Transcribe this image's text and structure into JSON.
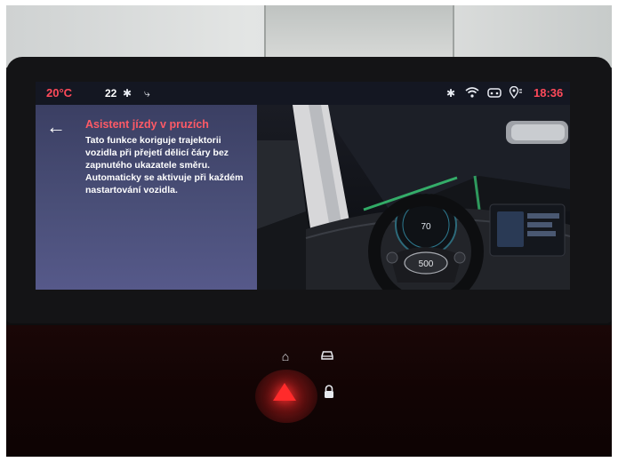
{
  "status_bar": {
    "outside_temp": "20°C",
    "fan_setting": "22",
    "fan_icon": "fan-icon",
    "airflow_icon": "seat-airflow-icon",
    "right_icons": [
      "bluetooth-icon",
      "wifi-icon",
      "driver-profile-icon",
      "location-icon"
    ],
    "time": "18:36"
  },
  "info_panel": {
    "back_icon": "back-arrow-icon",
    "title": "Asistent jízdy v pruzích",
    "description": "Tato funkce koriguje trajektorii vozidla při přejetí dělicí čáry bez zapnutého ukazatele směru. Automaticky se aktivuje při každém nastartování vozidla."
  },
  "illustration": {
    "steering_badge": "500",
    "speed_readout": "70"
  },
  "hardware_buttons": {
    "home_icon": "home-icon",
    "car_icon": "car-icon",
    "hazard_icon": "hazard-warning-icon",
    "lock_icon": "lock-icon"
  },
  "colors": {
    "accent_red": "#ff4a5a",
    "panel_bg": "#4a4f78",
    "lane_green": "#3ad17a"
  }
}
